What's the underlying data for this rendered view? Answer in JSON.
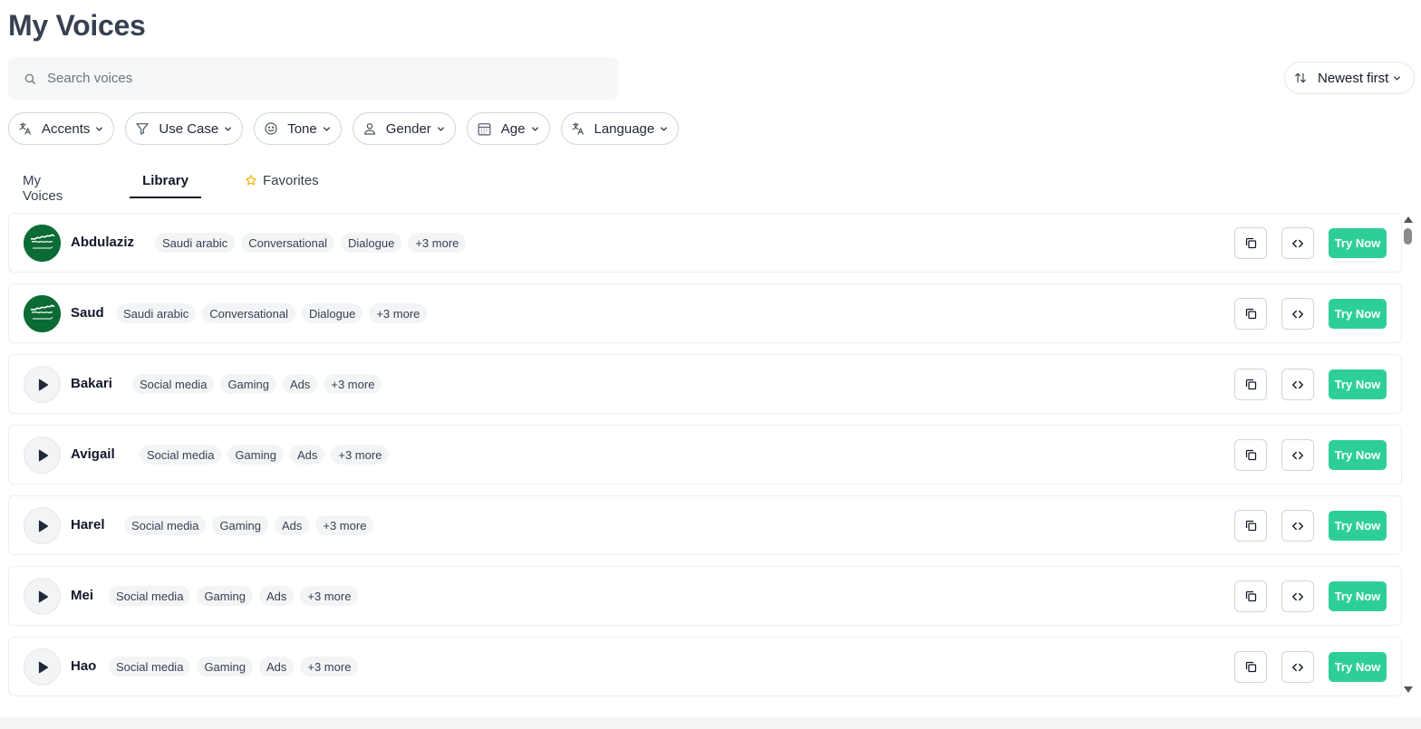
{
  "page": {
    "title": "My Voices"
  },
  "search": {
    "placeholder": "Search voices",
    "value": ""
  },
  "sort": {
    "label": "Newest first"
  },
  "filters": [
    {
      "label": "Accents",
      "icon": "translate-icon"
    },
    {
      "label": "Use Case",
      "icon": "filter-icon"
    },
    {
      "label": "Tone",
      "icon": "smile-icon"
    },
    {
      "label": "Gender",
      "icon": "person-icon"
    },
    {
      "label": "Age",
      "icon": "calendar-icon"
    },
    {
      "label": "Language",
      "icon": "translate-icon"
    }
  ],
  "tabs": [
    {
      "label": "My Voices",
      "active": false
    },
    {
      "label": "Library",
      "active": true
    },
    {
      "label": "Favorites",
      "active": false,
      "icon": "star-icon"
    }
  ],
  "colors": {
    "accent": "#2ecf97",
    "flag_green": "#0a6b35",
    "star": "#f5b301"
  },
  "actions": {
    "try_label": "Try Now"
  },
  "voices": [
    {
      "name": "Abdulaziz",
      "avatar": "flag",
      "tags": [
        "Saudi arabic",
        "Conversational",
        "Dialogue",
        "+3 more"
      ]
    },
    {
      "name": "Saud",
      "avatar": "flag",
      "tags": [
        "Saudi arabic",
        "Conversational",
        "Dialogue",
        "+3 more"
      ]
    },
    {
      "name": "Bakari",
      "avatar": "play",
      "tags": [
        "Social media",
        "Gaming",
        "Ads",
        "+3 more"
      ]
    },
    {
      "name": "Avigail",
      "avatar": "play",
      "tags": [
        "Social media",
        "Gaming",
        "Ads",
        "+3 more"
      ]
    },
    {
      "name": "Harel",
      "avatar": "play",
      "tags": [
        "Social media",
        "Gaming",
        "Ads",
        "+3 more"
      ]
    },
    {
      "name": "Mei",
      "avatar": "play",
      "tags": [
        "Social media",
        "Gaming",
        "Ads",
        "+3 more"
      ]
    },
    {
      "name": "Hao",
      "avatar": "play",
      "tags": [
        "Social media",
        "Gaming",
        "Ads",
        "+3 more"
      ]
    }
  ]
}
